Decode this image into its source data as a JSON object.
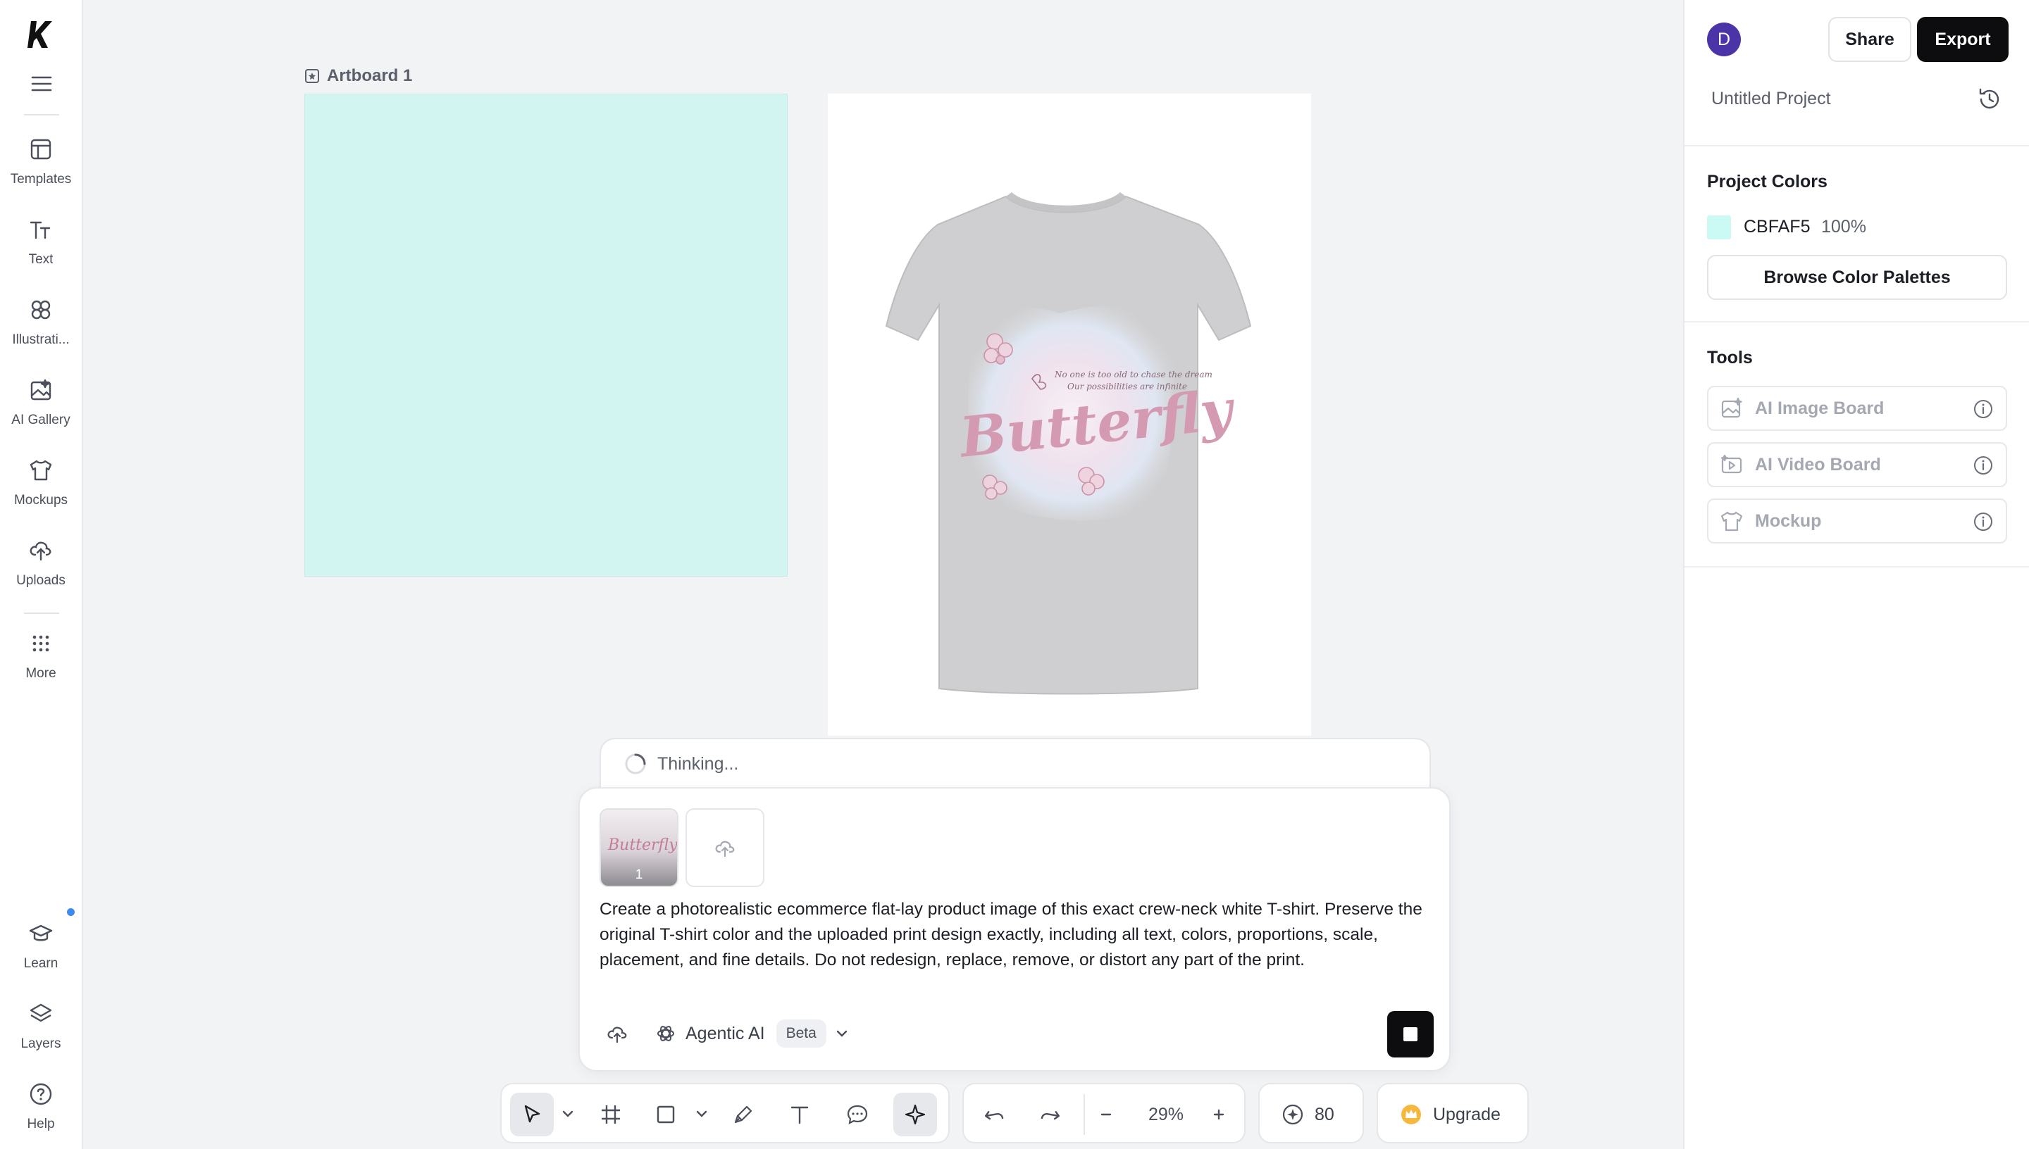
{
  "sidebar": {
    "items": [
      {
        "label": "Templates",
        "icon": "templates-icon"
      },
      {
        "label": "Text",
        "icon": "text-icon"
      },
      {
        "label": "Illustrati...",
        "icon": "illustrations-icon"
      },
      {
        "label": "AI Gallery",
        "icon": "ai-gallery-icon"
      },
      {
        "label": "Mockups",
        "icon": "tshirt-icon"
      },
      {
        "label": "Uploads",
        "icon": "upload-icon"
      },
      {
        "label": "More",
        "icon": "grid-dots-icon"
      }
    ],
    "bottom": [
      {
        "label": "Learn",
        "icon": "graduation-cap-icon"
      },
      {
        "label": "Layers",
        "icon": "layers-icon"
      },
      {
        "label": "Help",
        "icon": "help-icon"
      }
    ]
  },
  "canvas": {
    "artboard_label": "Artboard 1",
    "artboard1_fill": "#D3F5F2",
    "tshirt_print": {
      "headline": "Butterfly",
      "tagline_1": "No one is too old to chase the dream",
      "tagline_2": "Our possibilities are infinite"
    }
  },
  "assistant": {
    "status": "Thinking...",
    "attachment_count": "1",
    "attachment_preview_text": "Butterfly",
    "prompt": "Create a photorealistic ecommerce flat-lay product image of this exact crew-neck white T-shirt. Preserve the original T-shirt color and the uploaded print design exactly, including all text, colors, proportions, scale, placement, and fine details. Do not redesign, replace, remove, or distort any part of the print.",
    "mode_label": "Agentic AI",
    "mode_badge": "Beta"
  },
  "toolbar": {
    "zoom": "29%",
    "credits": "80",
    "upgrade_label": "Upgrade"
  },
  "right_panel": {
    "avatar_initial": "D",
    "share_label": "Share",
    "export_label": "Export",
    "project_name": "Untitled Project",
    "project_colors_heading": "Project Colors",
    "color_hex": "CBFAF5",
    "color_opacity": "100%",
    "browse_palettes_label": "Browse Color Palettes",
    "tools_heading": "Tools",
    "tools": [
      {
        "label": "AI Image Board"
      },
      {
        "label": "AI Video Board"
      },
      {
        "label": "Mockup"
      }
    ]
  },
  "colors": {
    "accent_dark": "#0D0D0F",
    "avatar": "#4B34A8",
    "swatch": "#CBFAF5",
    "notification_dot": "#3D8BF2"
  }
}
